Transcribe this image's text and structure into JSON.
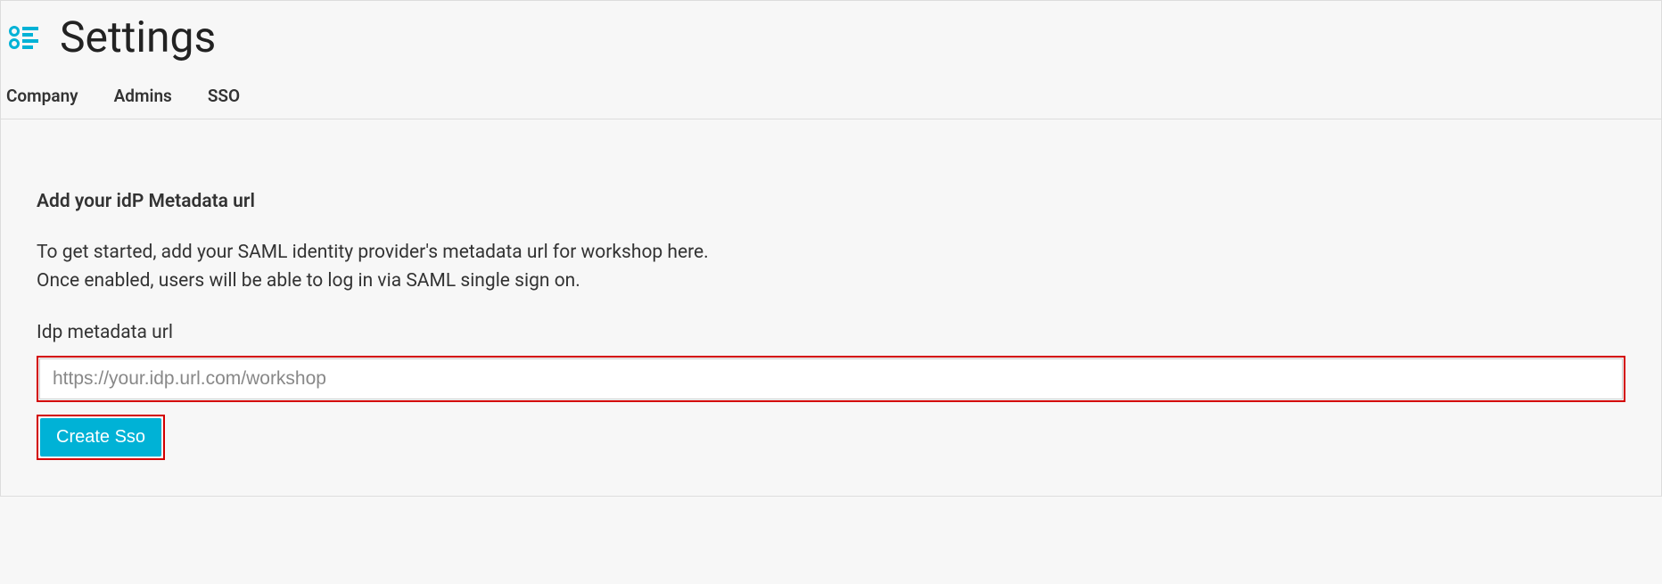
{
  "header": {
    "title": "Settings"
  },
  "tabs": {
    "company": "Company",
    "admins": "Admins",
    "sso": "SSO"
  },
  "content": {
    "section_title": "Add your idP Metadata url",
    "description_line1": "To get started, add your SAML identity provider's metadata url for workshop here.",
    "description_line2": "Once enabled, users will be able to log in via SAML single sign on.",
    "field_label": "Idp metadata url",
    "input_placeholder": "https://your.idp.url.com/workshop",
    "button_label": "Create Sso"
  }
}
